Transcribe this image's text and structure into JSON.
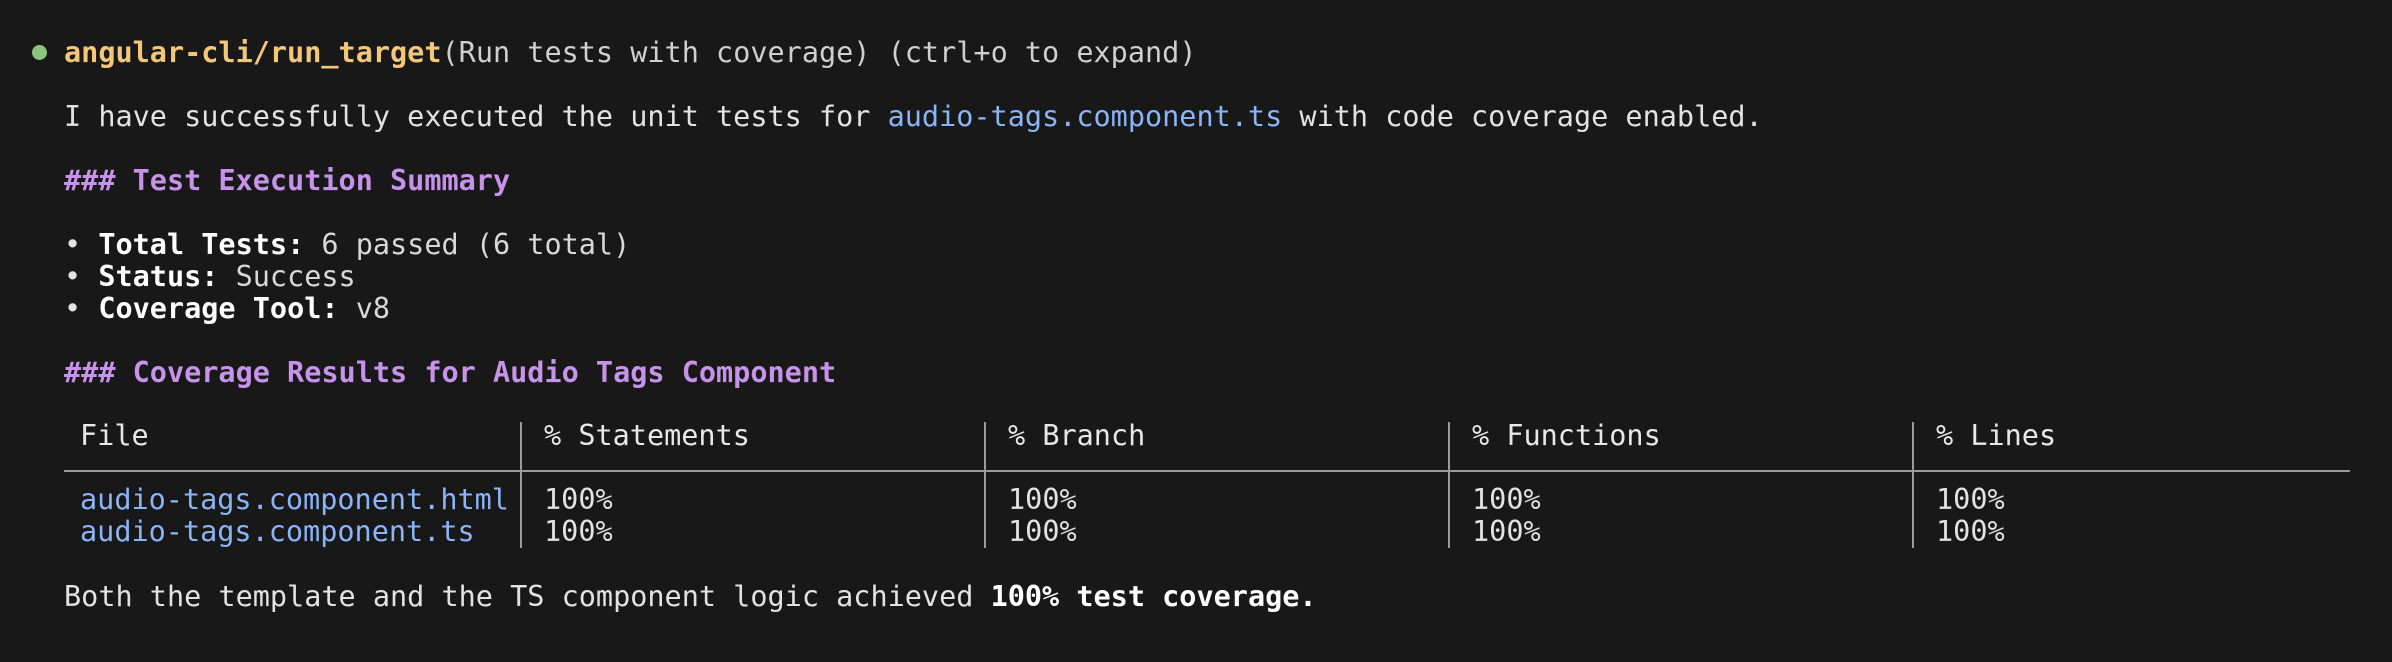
{
  "tool_call": {
    "status_dot_color": "#8bc47e",
    "name": "angular-cli/run_target",
    "args": "(Run tests with coverage) (ctrl+o to expand)"
  },
  "intro": {
    "before": "I have successfully executed the unit tests for ",
    "file": "audio-tags.component.ts",
    "after": " with code coverage enabled."
  },
  "summary": {
    "heading": "### Test Execution Summary",
    "items": [
      {
        "label": "Total Tests:",
        "value": " 6 passed (6 total)"
      },
      {
        "label": "Status:",
        "value": " Success"
      },
      {
        "label": "Coverage Tool:",
        "value": " v8"
      }
    ]
  },
  "coverage": {
    "heading": "### Coverage Results for Audio Tags Component",
    "columns": [
      "File",
      "% Statements",
      "% Branch",
      "% Functions",
      "% Lines"
    ],
    "rows": [
      {
        "file": "audio-tags.component.html",
        "statements": "100%",
        "branch": "100%",
        "functions": "100%",
        "lines": "100%"
      },
      {
        "file": "audio-tags.component.ts",
        "statements": "100%",
        "branch": "100%",
        "functions": "100%",
        "lines": "100%"
      }
    ]
  },
  "conclusion": {
    "before": "Both the template and the TS component logic achieved ",
    "emphasis": "100% test coverage."
  }
}
